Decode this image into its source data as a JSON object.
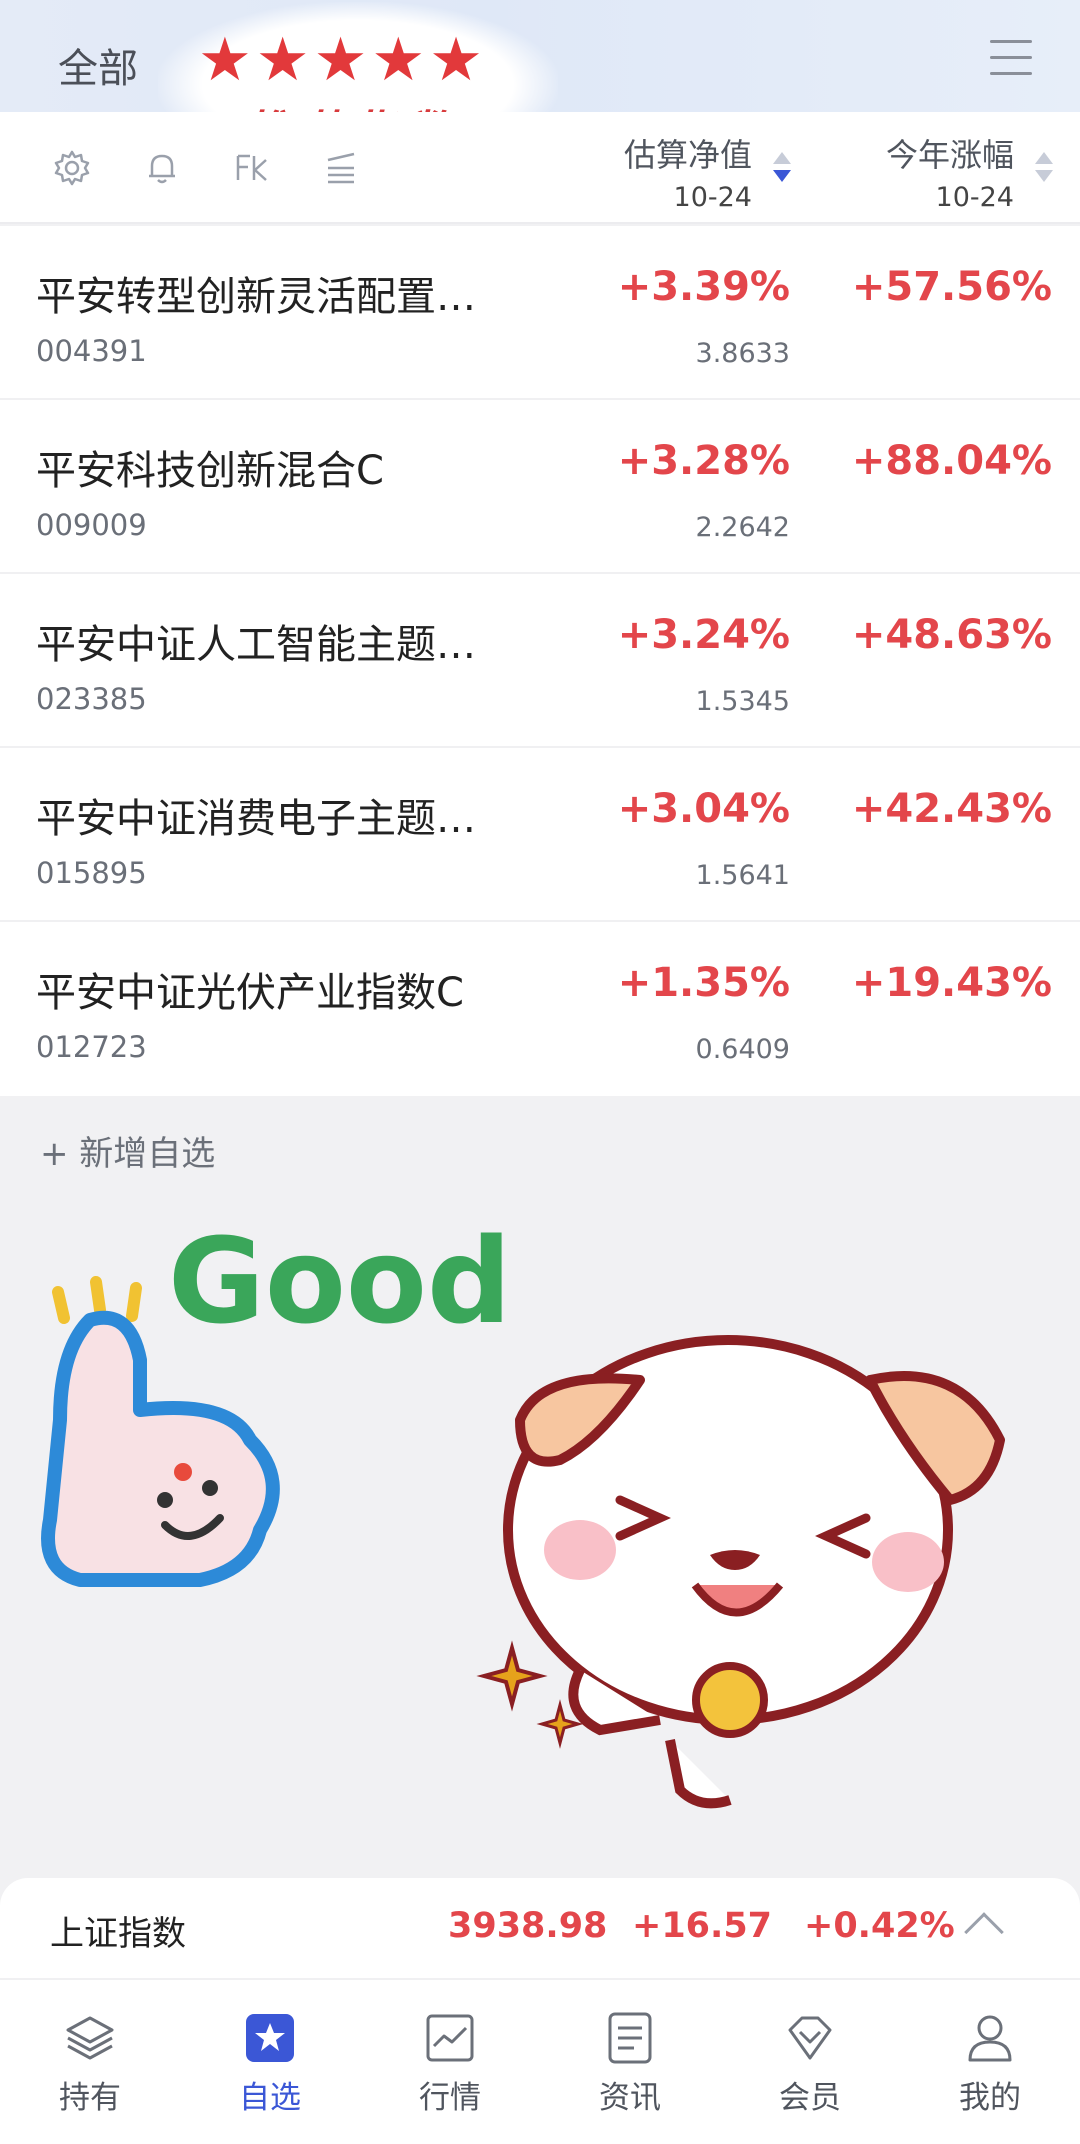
{
  "header": {
    "tab_all": "全部",
    "stars": "★★★★★",
    "rec_title": "推荐指数"
  },
  "toolbar": {
    "icons": [
      "gear-icon",
      "bell-icon",
      "fk-icon",
      "sort-lines-icon"
    ],
    "col_nav": {
      "title": "估算净值",
      "date": "10-24"
    },
    "col_ytd": {
      "title": "今年涨幅",
      "date": "10-24"
    }
  },
  "funds": [
    {
      "name": "平安转型创新灵活配置…",
      "code": "004391",
      "est_change": "+3.39%",
      "nav": "3.8633",
      "ytd": "+57.56%"
    },
    {
      "name": "平安科技创新混合C",
      "code": "009009",
      "est_change": "+3.28%",
      "nav": "2.2642",
      "ytd": "+88.04%"
    },
    {
      "name": "平安中证人工智能主题…",
      "code": "023385",
      "est_change": "+3.24%",
      "nav": "1.5345",
      "ytd": "+48.63%"
    },
    {
      "name": "平安中证消费电子主题…",
      "code": "015895",
      "est_change": "+3.04%",
      "nav": "1.5641",
      "ytd": "+42.43%"
    },
    {
      "name": "平安中证光伏产业指数C",
      "code": "012723",
      "est_change": "+1.35%",
      "nav": "0.6409",
      "ytd": "+19.43%"
    }
  ],
  "add_fav": "+ 新增自选",
  "sticker": {
    "text": "Good"
  },
  "index_bar": {
    "name": "上证指数",
    "value": "3938.98",
    "change": "+16.57",
    "change_pct": "+0.42%"
  },
  "tabs": [
    {
      "label": "持有",
      "icon": "layers-icon"
    },
    {
      "label": "自选",
      "icon": "star-icon",
      "active": true
    },
    {
      "label": "行情",
      "icon": "chart-icon"
    },
    {
      "label": "资讯",
      "icon": "document-icon"
    },
    {
      "label": "会员",
      "icon": "diamond-icon"
    },
    {
      "label": "我的",
      "icon": "user-icon"
    }
  ],
  "colors": {
    "up_red": "#e3464b",
    "active_blue": "#3b57d6",
    "header_bg": "#e4ebf7"
  }
}
